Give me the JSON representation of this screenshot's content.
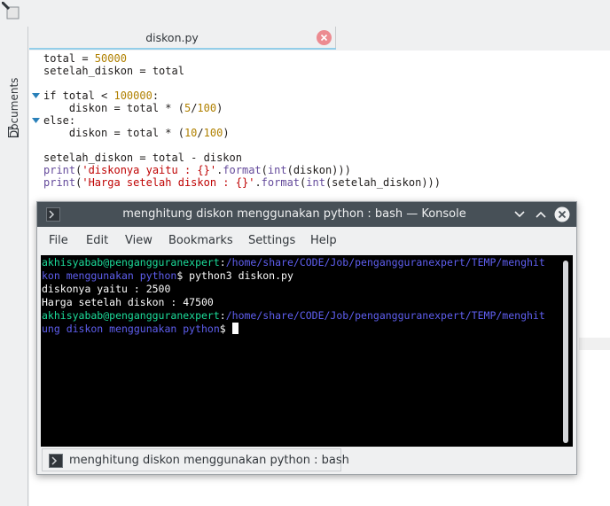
{
  "editor": {
    "tab_title": "diskon.py",
    "side_panel_label": "Documents",
    "code_lines": [
      [
        {
          "t": "total = ",
          "c": "kw"
        },
        {
          "t": "50000",
          "c": "n"
        }
      ],
      [
        {
          "t": "setelah_diskon = total",
          "c": "kw"
        }
      ],
      [],
      [
        {
          "t": "if total < ",
          "c": "kw"
        },
        {
          "t": "100000",
          "c": "n"
        },
        {
          "t": ":",
          "c": "kw"
        }
      ],
      [
        {
          "t": "    diskon = total * (",
          "c": "kw"
        },
        {
          "t": "5",
          "c": "n"
        },
        {
          "t": "/",
          "c": "kw"
        },
        {
          "t": "100",
          "c": "n"
        },
        {
          "t": ")",
          "c": "kw"
        }
      ],
      [
        {
          "t": "else:",
          "c": "kw"
        }
      ],
      [
        {
          "t": "    diskon = total * (",
          "c": "kw"
        },
        {
          "t": "10",
          "c": "n"
        },
        {
          "t": "/",
          "c": "kw"
        },
        {
          "t": "100",
          "c": "n"
        },
        {
          "t": ")",
          "c": "kw"
        }
      ],
      [],
      [
        {
          "t": "setelah_diskon = total - diskon",
          "c": "kw"
        }
      ],
      [
        {
          "t": "print",
          "c": "b"
        },
        {
          "t": "(",
          "c": "kw"
        },
        {
          "t": "'diskonya yaitu : {}'",
          "c": "s"
        },
        {
          "t": ".",
          "c": "kw"
        },
        {
          "t": "format",
          "c": "b"
        },
        {
          "t": "(",
          "c": "kw"
        },
        {
          "t": "int",
          "c": "b"
        },
        {
          "t": "(diskon)))",
          "c": "kw"
        }
      ],
      [
        {
          "t": "print",
          "c": "b"
        },
        {
          "t": "(",
          "c": "kw"
        },
        {
          "t": "'Harga setelah diskon : {}'",
          "c": "s"
        },
        {
          "t": ".",
          "c": "kw"
        },
        {
          "t": "format",
          "c": "b"
        },
        {
          "t": "(",
          "c": "kw"
        },
        {
          "t": "int",
          "c": "b"
        },
        {
          "t": "(setelah_diskon)))",
          "c": "kw"
        }
      ]
    ]
  },
  "konsole": {
    "title": "menghitung diskon menggunakan python : bash — Konsole",
    "menu": {
      "file": "File",
      "edit": "Edit",
      "view": "View",
      "bookmarks": "Bookmarks",
      "settings": "Settings",
      "help": "Help"
    },
    "terminal_lines": [
      [
        {
          "t": "akhisyabab@pengangguranexpert",
          "c": "tg"
        },
        {
          "t": ":",
          "c": "tw"
        },
        {
          "t": "/home/share/CODE/Job/pengangguranexpert/TEMP/menghit",
          "c": "tb"
        }
      ],
      [
        {
          "t": "kon menggunakan python",
          "c": "tb"
        },
        {
          "t": "$ python3 diskon.py",
          "c": "tw"
        }
      ],
      [
        {
          "t": "diskonya yaitu : 2500",
          "c": "tw"
        }
      ],
      [
        {
          "t": "Harga setelah diskon : 47500",
          "c": "tw"
        }
      ],
      [
        {
          "t": "akhisyabab@pengangguranexpert",
          "c": "tg"
        },
        {
          "t": ":",
          "c": "tw"
        },
        {
          "t": "/home/share/CODE/Job/pengangguranexpert/TEMP/menghit",
          "c": "tb"
        }
      ],
      [
        {
          "t": "ung diskon menggunakan python",
          "c": "tb"
        },
        {
          "t": "$ ",
          "c": "tw"
        },
        {
          "cursor": true
        }
      ]
    ],
    "session_tab": "menghitung diskon menggunakan python : bash"
  },
  "colors": {
    "titlebar": "#475057",
    "terminal_bg": "#000000",
    "prompt_user": "#1cdc9a",
    "prompt_path": "#5f5ff0",
    "accent": "#93cee9",
    "close_tab": "#ec8b91"
  }
}
